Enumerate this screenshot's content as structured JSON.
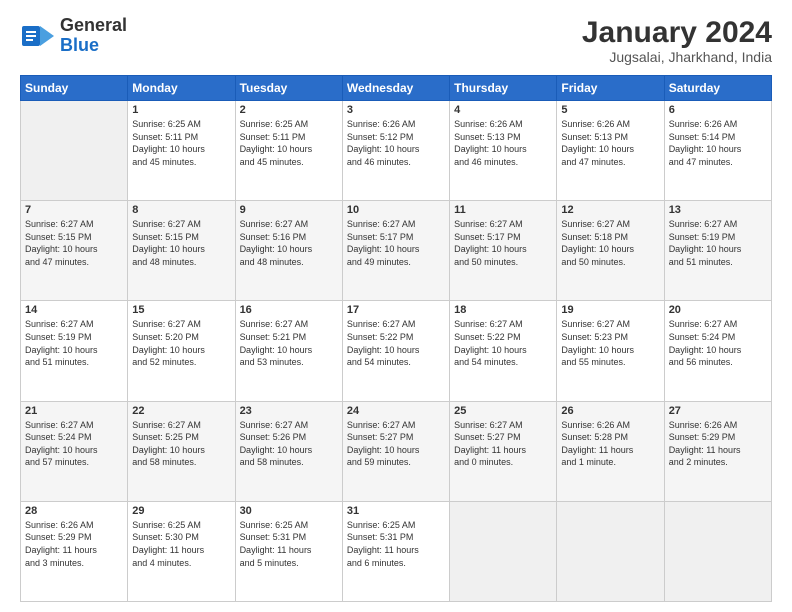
{
  "header": {
    "logo_line1": "General",
    "logo_line2": "Blue",
    "title": "January 2024",
    "subtitle": "Jugsalai, Jharkhand, India"
  },
  "calendar": {
    "days_of_week": [
      "Sunday",
      "Monday",
      "Tuesday",
      "Wednesday",
      "Thursday",
      "Friday",
      "Saturday"
    ],
    "weeks": [
      [
        {
          "num": "",
          "info": ""
        },
        {
          "num": "1",
          "info": "Sunrise: 6:25 AM\nSunset: 5:11 PM\nDaylight: 10 hours\nand 45 minutes."
        },
        {
          "num": "2",
          "info": "Sunrise: 6:25 AM\nSunset: 5:11 PM\nDaylight: 10 hours\nand 45 minutes."
        },
        {
          "num": "3",
          "info": "Sunrise: 6:26 AM\nSunset: 5:12 PM\nDaylight: 10 hours\nand 46 minutes."
        },
        {
          "num": "4",
          "info": "Sunrise: 6:26 AM\nSunset: 5:13 PM\nDaylight: 10 hours\nand 46 minutes."
        },
        {
          "num": "5",
          "info": "Sunrise: 6:26 AM\nSunset: 5:13 PM\nDaylight: 10 hours\nand 47 minutes."
        },
        {
          "num": "6",
          "info": "Sunrise: 6:26 AM\nSunset: 5:14 PM\nDaylight: 10 hours\nand 47 minutes."
        }
      ],
      [
        {
          "num": "7",
          "info": "Sunrise: 6:27 AM\nSunset: 5:15 PM\nDaylight: 10 hours\nand 47 minutes."
        },
        {
          "num": "8",
          "info": "Sunrise: 6:27 AM\nSunset: 5:15 PM\nDaylight: 10 hours\nand 48 minutes."
        },
        {
          "num": "9",
          "info": "Sunrise: 6:27 AM\nSunset: 5:16 PM\nDaylight: 10 hours\nand 48 minutes."
        },
        {
          "num": "10",
          "info": "Sunrise: 6:27 AM\nSunset: 5:17 PM\nDaylight: 10 hours\nand 49 minutes."
        },
        {
          "num": "11",
          "info": "Sunrise: 6:27 AM\nSunset: 5:17 PM\nDaylight: 10 hours\nand 50 minutes."
        },
        {
          "num": "12",
          "info": "Sunrise: 6:27 AM\nSunset: 5:18 PM\nDaylight: 10 hours\nand 50 minutes."
        },
        {
          "num": "13",
          "info": "Sunrise: 6:27 AM\nSunset: 5:19 PM\nDaylight: 10 hours\nand 51 minutes."
        }
      ],
      [
        {
          "num": "14",
          "info": "Sunrise: 6:27 AM\nSunset: 5:19 PM\nDaylight: 10 hours\nand 51 minutes."
        },
        {
          "num": "15",
          "info": "Sunrise: 6:27 AM\nSunset: 5:20 PM\nDaylight: 10 hours\nand 52 minutes."
        },
        {
          "num": "16",
          "info": "Sunrise: 6:27 AM\nSunset: 5:21 PM\nDaylight: 10 hours\nand 53 minutes."
        },
        {
          "num": "17",
          "info": "Sunrise: 6:27 AM\nSunset: 5:22 PM\nDaylight: 10 hours\nand 54 minutes."
        },
        {
          "num": "18",
          "info": "Sunrise: 6:27 AM\nSunset: 5:22 PM\nDaylight: 10 hours\nand 54 minutes."
        },
        {
          "num": "19",
          "info": "Sunrise: 6:27 AM\nSunset: 5:23 PM\nDaylight: 10 hours\nand 55 minutes."
        },
        {
          "num": "20",
          "info": "Sunrise: 6:27 AM\nSunset: 5:24 PM\nDaylight: 10 hours\nand 56 minutes."
        }
      ],
      [
        {
          "num": "21",
          "info": "Sunrise: 6:27 AM\nSunset: 5:24 PM\nDaylight: 10 hours\nand 57 minutes."
        },
        {
          "num": "22",
          "info": "Sunrise: 6:27 AM\nSunset: 5:25 PM\nDaylight: 10 hours\nand 58 minutes."
        },
        {
          "num": "23",
          "info": "Sunrise: 6:27 AM\nSunset: 5:26 PM\nDaylight: 10 hours\nand 58 minutes."
        },
        {
          "num": "24",
          "info": "Sunrise: 6:27 AM\nSunset: 5:27 PM\nDaylight: 10 hours\nand 59 minutes."
        },
        {
          "num": "25",
          "info": "Sunrise: 6:27 AM\nSunset: 5:27 PM\nDaylight: 11 hours\nand 0 minutes."
        },
        {
          "num": "26",
          "info": "Sunrise: 6:26 AM\nSunset: 5:28 PM\nDaylight: 11 hours\nand 1 minute."
        },
        {
          "num": "27",
          "info": "Sunrise: 6:26 AM\nSunset: 5:29 PM\nDaylight: 11 hours\nand 2 minutes."
        }
      ],
      [
        {
          "num": "28",
          "info": "Sunrise: 6:26 AM\nSunset: 5:29 PM\nDaylight: 11 hours\nand 3 minutes."
        },
        {
          "num": "29",
          "info": "Sunrise: 6:25 AM\nSunset: 5:30 PM\nDaylight: 11 hours\nand 4 minutes."
        },
        {
          "num": "30",
          "info": "Sunrise: 6:25 AM\nSunset: 5:31 PM\nDaylight: 11 hours\nand 5 minutes."
        },
        {
          "num": "31",
          "info": "Sunrise: 6:25 AM\nSunset: 5:31 PM\nDaylight: 11 hours\nand 6 minutes."
        },
        {
          "num": "",
          "info": ""
        },
        {
          "num": "",
          "info": ""
        },
        {
          "num": "",
          "info": ""
        }
      ]
    ]
  }
}
